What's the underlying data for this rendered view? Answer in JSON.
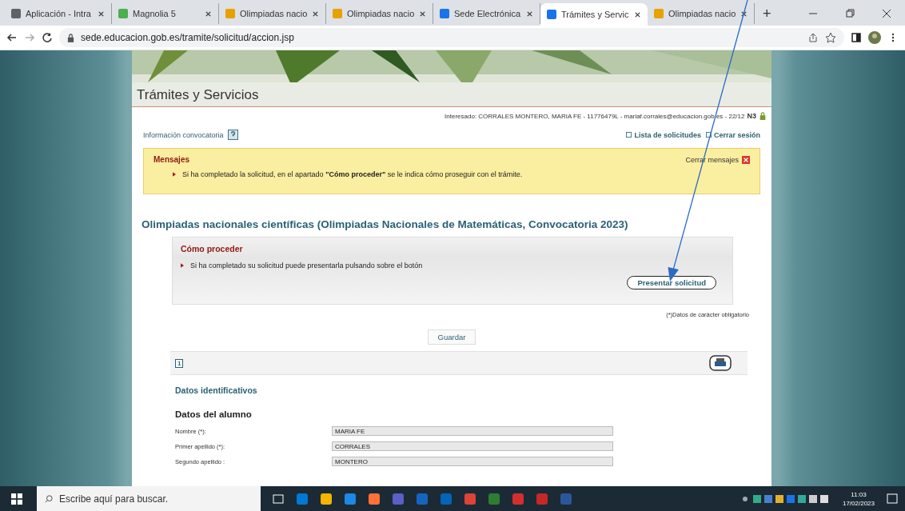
{
  "browser": {
    "tabs": [
      {
        "label": "Aplicación - Intra",
        "color": "#5f6368",
        "selected": false
      },
      {
        "label": "Magnolia 5",
        "color": "#4caf50",
        "selected": false
      },
      {
        "label": "Olimpiadas nacio",
        "color": "#e8a200",
        "selected": false
      },
      {
        "label": "Olimpiadas nacio",
        "color": "#e8a200",
        "selected": false
      },
      {
        "label": "Sede Electrónica",
        "color": "#1a73e8",
        "selected": false
      },
      {
        "label": "Trámites y Servic",
        "color": "#1a73e8",
        "selected": true
      },
      {
        "label": "Olimpiadas nacio",
        "color": "#e8a200",
        "selected": false
      }
    ],
    "new_tab": "+",
    "address": "sede.educacion.gob.es/tramite/solicitud/accion.jsp"
  },
  "page": {
    "title": "Trámites y Servicios",
    "user_line": "Interesado:  CORRALES MONTERO, MARIA FE - 11776479L  - mariaf.corrales@educacion.gob.es -  22/12",
    "level_badge": "N3",
    "info_link": "Información convocatoria",
    "links": [
      "Lista de solicitudes",
      "Cerrar sesión"
    ],
    "messages": {
      "title": "Mensajes",
      "close": "Cerrar mensajes",
      "text": "Si ha completado la solicitud, en el apartado **\"Cómo proceder\"** se le indica cómo proseguir con el trámite."
    },
    "heading": "Olimpiadas nacionales científicas (Olimpiadas Nacionales de Matemáticas, Convocatoria 2023)",
    "proceed": {
      "title": "Cómo proceder",
      "text": "Si ha completado su solicitud puede presentarla pulsando sobre el botón",
      "button": "Presentar solicitud"
    },
    "required_note": "(*)Datos de carácter obligatorio",
    "save_button": "Guardar",
    "page_number": "1",
    "section": "Datos identificativos",
    "subsection": "Datos del alumno",
    "fields": [
      {
        "label": "Nombre (*):",
        "value": "MARIA FE"
      },
      {
        "label": "Primer apellido (*):",
        "value": "CORRALES"
      },
      {
        "label": "Segundo apellido :",
        "value": "MONTERO"
      }
    ]
  },
  "taskbar": {
    "search_placeholder": "Escribe aquí para buscar.",
    "time": "11:03",
    "date": "17/02/2023"
  }
}
